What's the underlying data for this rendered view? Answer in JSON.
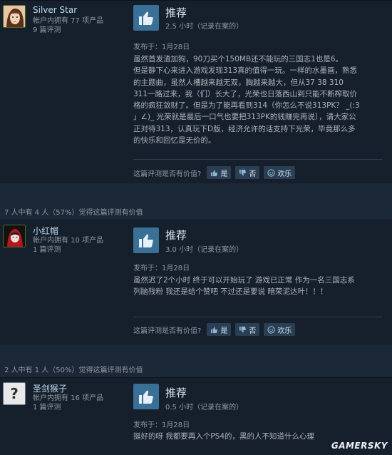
{
  "reviews": [
    {
      "author": "Silver Star",
      "games_owned": "帐户内拥有 77 项产品",
      "review_count": "9 篇评测",
      "verdict": "推荐",
      "hours": "2.5 小时（记录在案的）",
      "posted": "发布于：1月28日",
      "body_lines": [
        "虽然首发渣加狗，90刀买个150MB还不能玩的三国志1也是6。",
        "但是静下心来进入游戏发现313真的值得一玩。一样的水墨画，熟悉",
        "的主题曲，虽然人槽越来越无双，胸越来越大，但从37 38 310",
        "311一路过来，我（们）长大了，光荣也日落西山到只能不断榨取价",
        "格的疯狂敛财了。但是为了能再看到314（你怎么不说313PK？ _(:3",
        "」∠)_ 光荣就是最后一口气也要把313PK的钱赚完再说），请大家公",
        "正对待313，认真玩下D版，经济允许的话支持下光荣，毕竟那么多",
        "的快乐和回忆是无价的。"
      ],
      "vote_question": "这篇评测是否有价值?",
      "vote_yes": "是",
      "vote_no": "否",
      "vote_funny": "欢乐"
    },
    {
      "helpful_summary": "7 人中有 4 人（57%）觉得这篇评测有价值",
      "author": "小红帽",
      "games_owned": "帐户内拥有 10 项产品",
      "review_count": "1 篇评测",
      "verdict": "推荐",
      "hours": "3.0 小时（记录在案的）",
      "posted": "发布于：1月28日",
      "body_lines": [
        "虽然迟了2个小时 终于可以开始玩了 游戏已正常 作为一名三国志系",
        "列脑残粉 我还是给个赞吧 不过还是要说 暗荣泥达叶！！！"
      ],
      "vote_question": "这篇评测是否有价值?",
      "vote_yes": "是",
      "vote_no": "否",
      "vote_funny": "欢乐"
    },
    {
      "helpful_summary": "2 人中有 1 人（50%）觉得这篇评测有价值",
      "author": "圣剑猴子",
      "games_owned": "帐户内拥有 16 项产品",
      "review_count": "1 篇评测",
      "verdict": "推荐",
      "hours": "0.5 小时（记录在案的）",
      "posted": "发布于：1月28日",
      "body_lines": [
        "挺好的呀 我都要再入个PS4的，黑的人不知道什么心理"
      ]
    }
  ],
  "avatar_placeholder": "?",
  "watermark": "GAMERSKY",
  "colors": {
    "background": "#1b2838",
    "review_bg": "#16202d",
    "thumb_bg": "#3a6f96",
    "author_name": "#c1dbf4"
  }
}
